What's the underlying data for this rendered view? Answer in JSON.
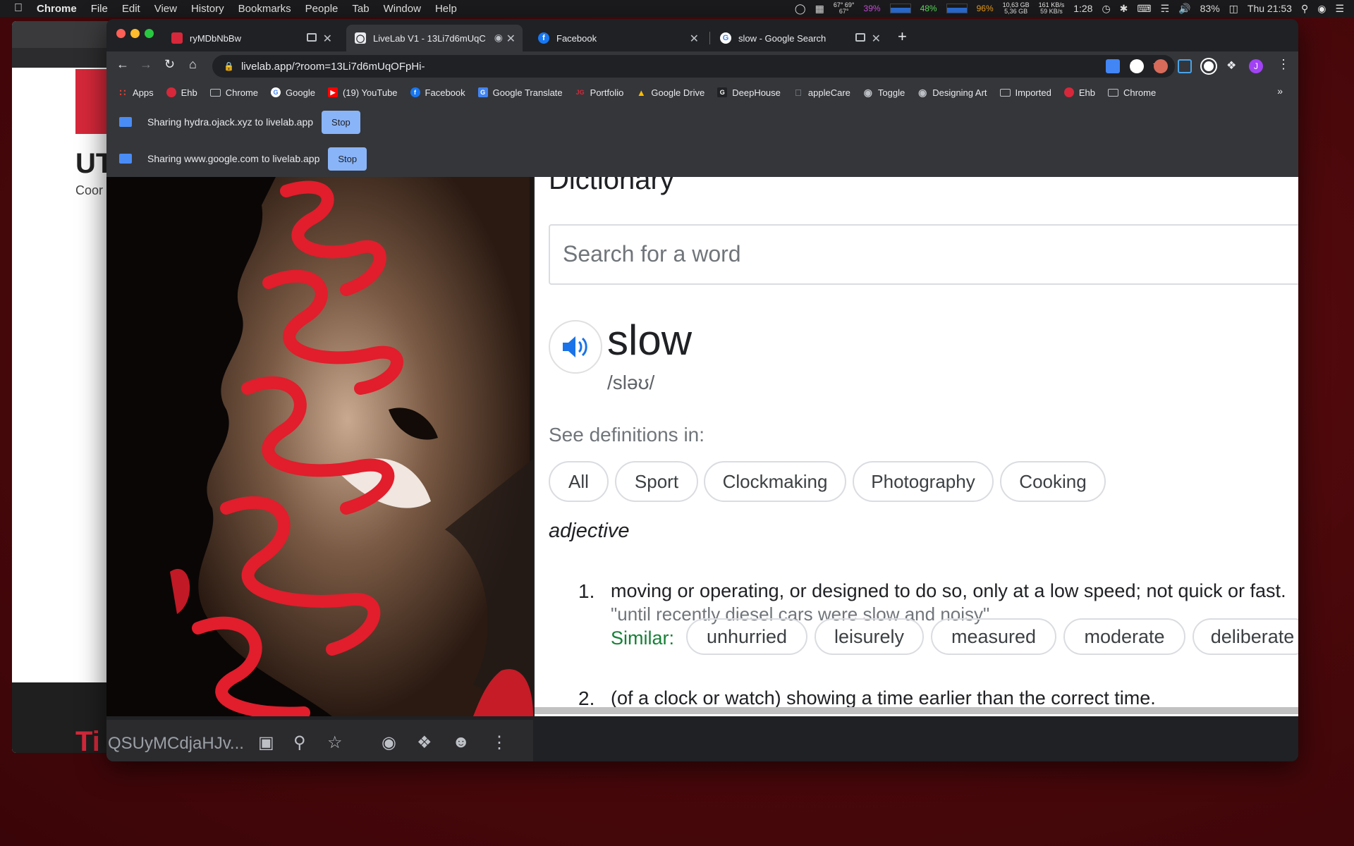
{
  "menubar": {
    "apple": "",
    "app": "Chrome",
    "items": [
      "File",
      "Edit",
      "View",
      "History",
      "Bookmarks",
      "People",
      "Tab",
      "Window",
      "Help"
    ],
    "temps": [
      "67° 69°",
      "67°"
    ],
    "cpu": "39%",
    "battery_pct_a": "48%",
    "mem_pct": "96%",
    "disk": [
      "10,63 GB",
      "5,36 GB"
    ],
    "net": [
      "161 KB/s",
      "59 KB/s"
    ],
    "timer": "1:28",
    "battery": "83%",
    "clock": "Thu 21:53"
  },
  "tabs": [
    {
      "title": "ryMDbNbBw",
      "favicon_color": "#d6283a"
    },
    {
      "title": "LiveLab V1 - 13Li7d6mUqC",
      "favicon_color": "#ffffff"
    },
    {
      "title": "Facebook",
      "favicon_color": "#1877f2"
    },
    {
      "title": "slow - Google Search",
      "favicon_color": "#ffffff"
    }
  ],
  "toolbar": {
    "url": "livelab.app/?room=13Li7d6mUqOFpHi-",
    "profile_initial": "J"
  },
  "bookmarks": [
    {
      "label": "Apps",
      "icon": "apps-grid-icon",
      "color": "#ea4335"
    },
    {
      "label": "Ehb",
      "icon": "ehb-logo-icon",
      "color": "#d6283a"
    },
    {
      "label": "Chrome",
      "icon": "folder-icon",
      "color": ""
    },
    {
      "label": "Google",
      "icon": "google-icon",
      "color": "#4285f4"
    },
    {
      "label": "(19) YouTube",
      "icon": "youtube-icon",
      "color": "#ff0000"
    },
    {
      "label": "Facebook",
      "icon": "facebook-icon",
      "color": "#1877f2"
    },
    {
      "label": "Google Translate",
      "icon": "translate-icon",
      "color": "#4285f4"
    },
    {
      "label": "Portfolio",
      "icon": "portfolio-icon",
      "color": "#d6283a"
    },
    {
      "label": "Google Drive",
      "icon": "drive-icon",
      "color": "#fbbc04"
    },
    {
      "label": "DeepHouse",
      "icon": "deephouse-icon",
      "color": "#202124"
    },
    {
      "label": "appleCare",
      "icon": "apple-icon",
      "color": "#9aa0a6"
    },
    {
      "label": "Toggle",
      "icon": "globe-icon",
      "color": "#bdc1c6"
    },
    {
      "label": "Designing Art",
      "icon": "globe-icon",
      "color": "#bdc1c6"
    },
    {
      "label": "Imported",
      "icon": "folder-icon",
      "color": ""
    },
    {
      "label": "Ehb",
      "icon": "ehb-logo-icon",
      "color": "#d6283a"
    },
    {
      "label": "Chrome",
      "icon": "folder-icon",
      "color": ""
    }
  ],
  "bookmarks_overflow": "»",
  "infobars": [
    {
      "text": "Sharing hydra.ojack.xyz to livelab.app",
      "button": "Stop"
    },
    {
      "text": "Sharing www.google.com to livelab.app",
      "button": "Stop"
    }
  ],
  "bg_window": {
    "red_letter": "T",
    "heading": "UT",
    "sub": "Coor",
    "footer_letters": "Ti"
  },
  "dictionary": {
    "heading": "Dictionary",
    "search_placeholder": "Search for a word",
    "word": "slow",
    "phonetic": "/sləʊ/",
    "see_definitions": "See definitions in:",
    "domains": [
      "All",
      "Sport",
      "Clockmaking",
      "Photography",
      "Cooking"
    ],
    "part_of_speech": "adjective",
    "definitions": [
      {
        "num": "1.",
        "text": "moving or operating, or designed to do so, only at a low speed; not quick or fast.",
        "example": "\"until recently diesel cars were slow and noisy\""
      },
      {
        "num": "2.",
        "text": "(of a clock or watch) showing a time earlier than the correct time.",
        "example": ""
      }
    ],
    "similar_label": "Similar:",
    "synonyms": [
      "unhurried",
      "leisurely",
      "measured",
      "moderate",
      "deliberate"
    ],
    "accent": "#1a73e8"
  },
  "inner_toolbar": {
    "url": "QSUyMCdjaHJv..."
  }
}
